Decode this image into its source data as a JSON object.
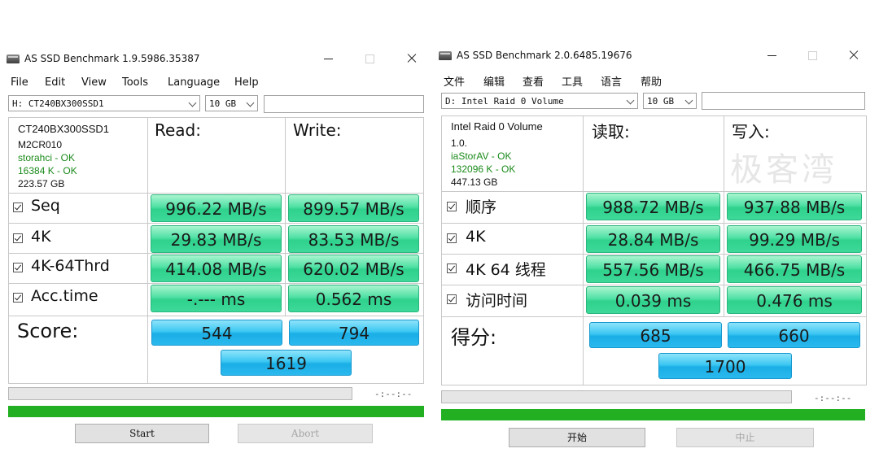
{
  "left": {
    "title": "AS SSD Benchmark 1.9.5986.35387",
    "menu": [
      "File",
      "Edit",
      "View",
      "Tools",
      "Language",
      "Help"
    ],
    "drive": "H: CT240BX300SSD1",
    "size": "10 GB",
    "info": {
      "model": "CT240BX300SSD1",
      "firmware": "M2CR010",
      "driver": "storahci - OK",
      "alignment": "16384 K - OK",
      "capacity": "223.57 GB"
    },
    "read_header": "Read:",
    "write_header": "Write:",
    "rows": [
      {
        "label": "Seq",
        "read": "996.22 MB/s",
        "write": "899.57 MB/s"
      },
      {
        "label": "4K",
        "read": "29.83 MB/s",
        "write": "83.53 MB/s"
      },
      {
        "label": "4K-64Thrd",
        "read": "414.08 MB/s",
        "write": "620.02 MB/s"
      },
      {
        "label": "Acc.time",
        "read": "-.--- ms",
        "write": "0.562 ms"
      }
    ],
    "score_label": "Score:",
    "score_read": "544",
    "score_write": "794",
    "score_total": "1619",
    "time": "-:--:--",
    "start": "Start",
    "abort": "Abort"
  },
  "right": {
    "title": "AS SSD Benchmark 2.0.6485.19676",
    "menu": [
      "文件",
      "编辑",
      "查看",
      "工具",
      "语言",
      "帮助"
    ],
    "drive": "D: Intel Raid 0 Volume",
    "size": "10 GB",
    "info": {
      "model": "Intel Raid 0 Volume",
      "firmware": "1.0.",
      "driver": "iaStorAV - OK",
      "alignment": "132096 K - OK",
      "capacity": "447.13 GB"
    },
    "read_header": "读取:",
    "write_header": "写入:",
    "watermark": "极客湾",
    "rows": [
      {
        "label": "顺序",
        "read": "988.72 MB/s",
        "write": "937.88 MB/s"
      },
      {
        "label": "4K",
        "read": "28.84 MB/s",
        "write": "99.29 MB/s"
      },
      {
        "label": "4K 64 线程",
        "read": "557.56 MB/s",
        "write": "466.75 MB/s"
      },
      {
        "label": "访问时间",
        "read": "0.039 ms",
        "write": "0.476 ms"
      }
    ],
    "score_label": "得分:",
    "score_read": "685",
    "score_write": "660",
    "score_total": "1700",
    "time": "-:--:--",
    "start": "开始",
    "abort": "中止"
  },
  "colors": {
    "result_cell": "#3ed99a",
    "score_cell": "#2bb9ee",
    "progress_green": "#22b022",
    "info_green": "#1a8a1a"
  },
  "icons": [
    "ssd-app-icon",
    "minimize-icon",
    "maximize-icon",
    "close-icon",
    "checkbox-checked-icon",
    "dropdown-arrow-icon"
  ]
}
